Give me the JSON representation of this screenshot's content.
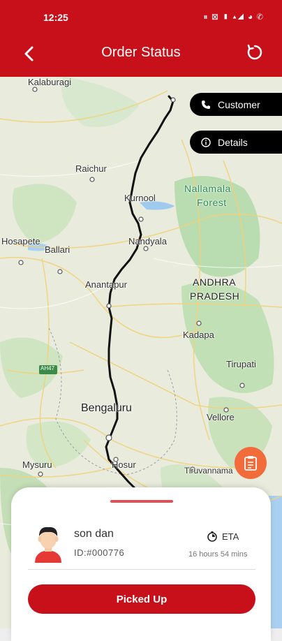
{
  "status_bar": {
    "time": "12:25",
    "icons": "⏸ ⊠ ▮ ▴◢ ◕ ✆"
  },
  "app_bar": {
    "title": "Order Status"
  },
  "map": {
    "labels": {
      "kalaburagi": "Kalaburagi",
      "raichur": "Raichur",
      "kurnool": "Kurnool",
      "nallamala": "Nallamala",
      "forest": "Forest",
      "hosapete": "Hosapete",
      "ballari": "Ballari",
      "nandyala": "Nandyala",
      "andhra": "ANDHRA",
      "pradesh": "PRADESH",
      "anantapur": "Anantapur",
      "kadapa": "Kadapa",
      "tirupati": "Tirupati",
      "ah47": "AH47",
      "bengaluru": "Bengaluru",
      "vellore": "Vellore",
      "mysuru": "Mysuru",
      "hosur": "Hosur",
      "tiruvannama": "Tiruvannama"
    }
  },
  "actions": {
    "customer": "Customer",
    "details": "Details"
  },
  "order": {
    "name": "son dan",
    "id": "ID:#000776",
    "eta_label": "ETA",
    "eta_value": "16 hours 54 mins",
    "button": "Picked Up"
  },
  "colors": {
    "primary": "#c8101a",
    "fab": "#f26b3a",
    "route": "#111111"
  }
}
